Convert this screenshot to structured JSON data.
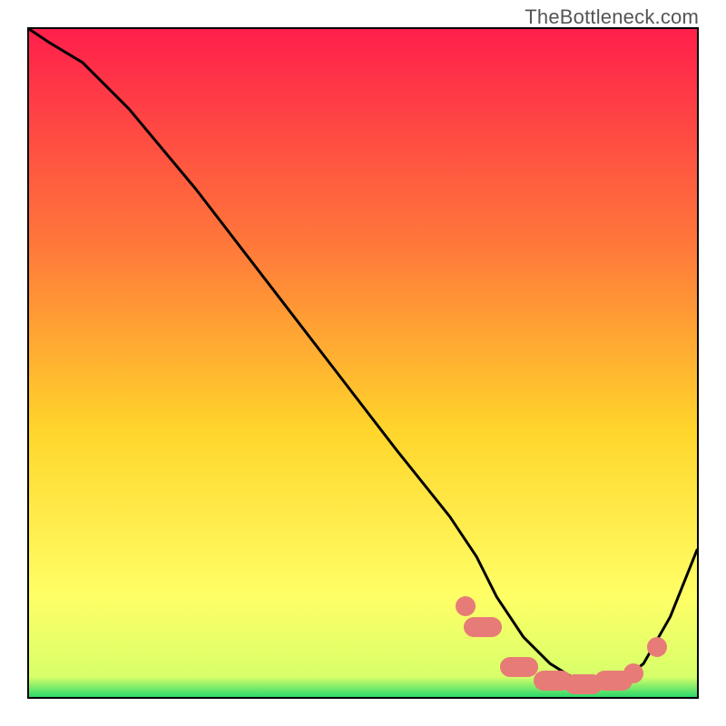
{
  "watermark": "TheBottleneck.com",
  "colors": {
    "gradient_top": "#ff1f4b",
    "gradient_mid1": "#ff7a3a",
    "gradient_mid2": "#ffd52b",
    "gradient_mid3": "#ffff66",
    "gradient_bottom": "#2bd96b",
    "curve": "#000000",
    "marker": "#e77b78",
    "border": "#000000"
  },
  "chart_data": {
    "type": "line",
    "title": "",
    "xlabel": "",
    "ylabel": "",
    "xlim": [
      0,
      100
    ],
    "ylim": [
      0,
      100
    ],
    "grid": false,
    "legend": false,
    "comment": "x = relative performance scale (0–100), y = bottleneck severity percentage (0=green/no bottleneck, 100=red/maximum bottleneck). Values estimated from the rendered curve.",
    "series": [
      {
        "name": "bottleneck-curve",
        "x": [
          0,
          3,
          8,
          15,
          25,
          35,
          45,
          55,
          63,
          67,
          70,
          74,
          78,
          82,
          86,
          89,
          92,
          96,
          100
        ],
        "y": [
          100,
          98,
          95,
          88,
          76,
          63,
          50,
          37,
          27,
          21,
          15,
          9,
          5,
          2.5,
          2,
          2.5,
          5,
          12,
          22
        ]
      }
    ],
    "markers": {
      "comment": "Highlighted points/pills along the trough of the curve (approximate positions).",
      "points": [
        {
          "x": 65,
          "y": 14,
          "shape": "dot"
        },
        {
          "x": 67.5,
          "y": 11,
          "shape": "pill"
        },
        {
          "x": 73,
          "y": 5,
          "shape": "pill"
        },
        {
          "x": 78,
          "y": 3,
          "shape": "pill"
        },
        {
          "x": 82.5,
          "y": 2.5,
          "shape": "pill"
        },
        {
          "x": 87,
          "y": 3,
          "shape": "pill"
        },
        {
          "x": 90,
          "y": 4,
          "shape": "dot"
        },
        {
          "x": 93.5,
          "y": 8,
          "shape": "dot"
        }
      ]
    }
  }
}
